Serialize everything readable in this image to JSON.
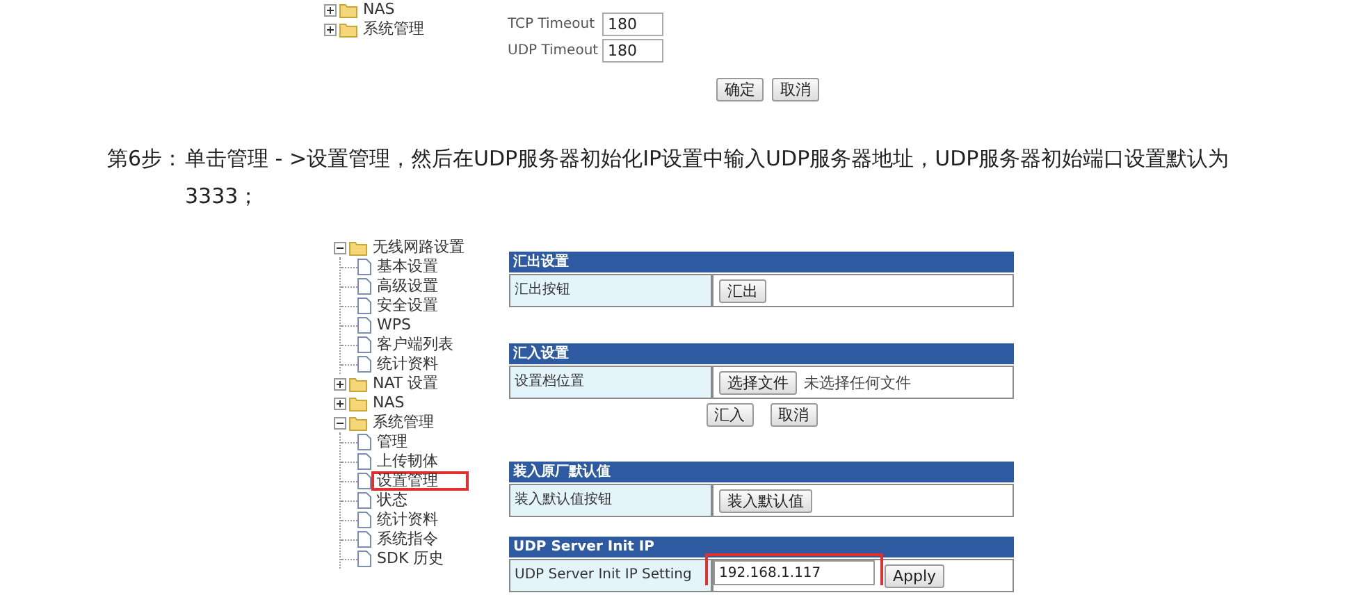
{
  "top_screenshot": {
    "tree": [
      {
        "label": "NAS",
        "expanded": false
      },
      {
        "label": "系统管理",
        "expanded": false
      }
    ],
    "fields": [
      {
        "label": "TCP Timeout",
        "value": "180"
      },
      {
        "label": "UDP Timeout",
        "value": "180"
      }
    ],
    "buttons": [
      "确定",
      "取消"
    ]
  },
  "step": {
    "label": "第6步：",
    "text": "单击管理 - >设置管理，然后在UDP服务器初始化IP设置中输入UDP服务器地址，UDP服务器初始端口设置默认为3333；"
  },
  "bottom_screenshot": {
    "tree": [
      {
        "label": "无线网路设置",
        "expanded": true,
        "children": [
          {
            "label": "基本设置",
            "highlighted": false
          },
          {
            "label": "高级设置",
            "highlighted": false
          },
          {
            "label": "安全设置",
            "highlighted": false
          },
          {
            "label": "WPS",
            "highlighted": false
          },
          {
            "label": "客户端列表",
            "highlighted": false
          },
          {
            "label": "统计资料",
            "highlighted": false
          }
        ]
      },
      {
        "label": "NAT 设置",
        "expanded": false
      },
      {
        "label": "NAS",
        "expanded": false
      },
      {
        "label": "系统管理",
        "expanded": true,
        "children": [
          {
            "label": "管理",
            "highlighted": false
          },
          {
            "label": "上传韧体",
            "highlighted": false
          },
          {
            "label": "设置管理",
            "highlighted": true
          },
          {
            "label": "状态",
            "highlighted": false
          },
          {
            "label": "统计资料",
            "highlighted": false
          },
          {
            "label": "系统指令",
            "highlighted": false
          },
          {
            "label": "SDK 历史",
            "highlighted": false
          }
        ]
      }
    ],
    "panels": [
      {
        "title": "汇出设置",
        "rows": [
          {
            "label": "汇出按钮",
            "controls": [
              {
                "kind": "button",
                "text": "汇出"
              }
            ]
          }
        ]
      },
      {
        "title": "汇入设置",
        "rows": [
          {
            "label": "设置档位置",
            "controls": [
              {
                "kind": "button",
                "text": "选择文件"
              },
              {
                "kind": "note",
                "text": "未选择任何文件"
              }
            ]
          }
        ],
        "buttons": [
          "汇入",
          "取消"
        ]
      },
      {
        "title": "装入原厂默认值",
        "rows": [
          {
            "label": "装入默认值按钮",
            "controls": [
              {
                "kind": "button",
                "text": "装入默认值"
              }
            ]
          }
        ]
      },
      {
        "title": "UDP Server Init IP",
        "rows": [
          {
            "label": "UDP Server Init IP Setting",
            "controls": [
              {
                "kind": "input",
                "value": "192.168.1.117",
                "highlighted": true
              },
              {
                "kind": "button",
                "text": "Apply"
              }
            ]
          }
        ]
      }
    ]
  }
}
